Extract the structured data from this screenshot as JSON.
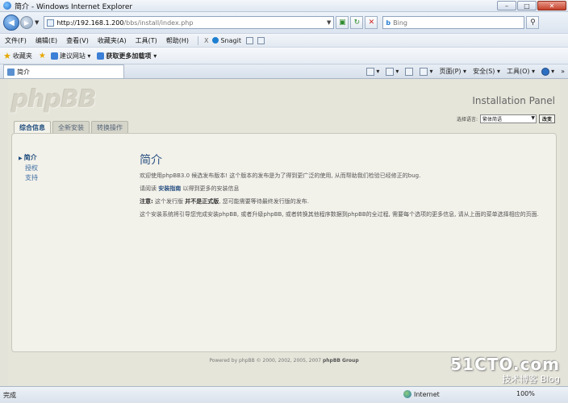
{
  "window": {
    "title": "简介 - Windows Internet Explorer",
    "controls": [
      "–",
      "□",
      "✕"
    ]
  },
  "address": {
    "url_host": "http://192.168.1.200",
    "url_path": "/bbs/install/index.php",
    "search_placeholder": "Bing"
  },
  "menu": {
    "items": [
      "文件(F)",
      "编辑(E)",
      "查看(V)",
      "收藏夹(A)",
      "工具(T)",
      "帮助(H)"
    ],
    "close_x": "X",
    "snagit": "Snagit"
  },
  "favorites": {
    "label": "收藏夹",
    "links": [
      "建议网站 ▾",
      "获取更多加载项 ▾"
    ]
  },
  "tabbar": {
    "tab_label": "简介",
    "commands": [
      "页面(P) ▾",
      "安全(S) ▾",
      "工具(O) ▾"
    ]
  },
  "phpbb": {
    "logo": "phpBB",
    "panel_title": "Installation Panel",
    "lang_label": "选择语言:",
    "lang_value": "繁体简语",
    "lang_button": "改变",
    "tabs": [
      "综合信息",
      "全新安装",
      "转换操作"
    ],
    "sidenav": [
      "简介",
      "授权",
      "支持"
    ],
    "heading": "简介",
    "para1": "欢迎使用phpBB3.0 候选发布版本! 这个版本的发布是为了得到更广泛的使用, 从而帮助我们检验已经修正的bug.",
    "para2_prefix": "请阅读",
    "para2_link": "安装指南",
    "para2_suffix": "以得到更多的安装信息",
    "para3_note": "注意:",
    "para3_mid": "这个发行版",
    "para3_bold": "并不是正式版",
    "para3_rest": ", 您可能需要等待最终发行版的发布.",
    "para4": "这个安装系统将引导您完成安装phpBB, 或者升级phpBB, 或者转换其他程序数据到phpBB的全过程, 需要每个选项的更多信息, 请从上面的菜单选择相应的页面.",
    "footer_prefix": "Powered by phpBB © 2000, 2002, 2005, 2007",
    "footer_group": "phpBB Group"
  },
  "watermark": {
    "main": "51CTO.com",
    "sub": "技术博客  Blog"
  },
  "status": {
    "text": "完成",
    "zone": "Internet",
    "zoom": "100%"
  }
}
